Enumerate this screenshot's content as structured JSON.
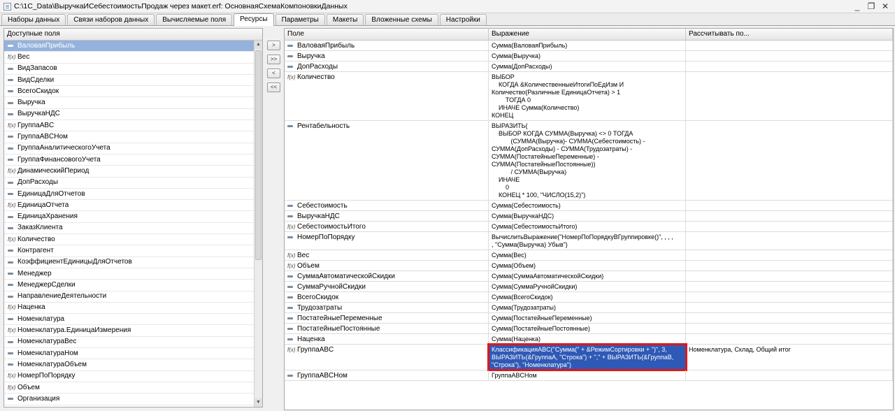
{
  "window": {
    "title": "C:\\1C_Data\\ВыручкаИСебестоимостьПродаж через макет.erf: ОсновнаяСхемаКомпоновкиДанных"
  },
  "tabs": [
    "Наборы данных",
    "Связи наборов данных",
    "Вычисляемые поля",
    "Ресурсы",
    "Параметры",
    "Макеты",
    "Вложенные схемы",
    "Настройки"
  ],
  "active_tab": "Ресурсы",
  "left": {
    "header": "Доступные поля",
    "items": [
      {
        "label": "ВаловаяПрибыль",
        "icon": "field",
        "selected": true
      },
      {
        "label": "Вес",
        "icon": "func"
      },
      {
        "label": "ВидЗапасов",
        "icon": "field"
      },
      {
        "label": "ВидСделки",
        "icon": "field"
      },
      {
        "label": "ВсегоСкидок",
        "icon": "field"
      },
      {
        "label": "Выручка",
        "icon": "field"
      },
      {
        "label": "ВыручкаНДС",
        "icon": "field"
      },
      {
        "label": "ГруппаABC",
        "icon": "func"
      },
      {
        "label": "ГруппаABCНом",
        "icon": "field"
      },
      {
        "label": "ГруппаАналитическогоУчета",
        "icon": "field"
      },
      {
        "label": "ГруппаФинансовогоУчета",
        "icon": "field"
      },
      {
        "label": "ДинамическийПериод",
        "icon": "func"
      },
      {
        "label": "ДопРасходы",
        "icon": "field"
      },
      {
        "label": "ЕдиницаДляОтчетов",
        "icon": "field"
      },
      {
        "label": "ЕдиницаОтчета",
        "icon": "func"
      },
      {
        "label": "ЕдиницаХранения",
        "icon": "field"
      },
      {
        "label": "ЗаказКлиента",
        "icon": "field"
      },
      {
        "label": "Количество",
        "icon": "func"
      },
      {
        "label": "Контрагент",
        "icon": "field"
      },
      {
        "label": "КоэффициентЕдиницыДляОтчетов",
        "icon": "field"
      },
      {
        "label": "Менеджер",
        "icon": "field"
      },
      {
        "label": "МенеджерСделки",
        "icon": "field"
      },
      {
        "label": "НаправлениеДеятельности",
        "icon": "field"
      },
      {
        "label": "Наценка",
        "icon": "func"
      },
      {
        "label": "Номенклатура",
        "icon": "field"
      },
      {
        "label": "Номенклатура.ЕдиницаИзмерения",
        "icon": "func"
      },
      {
        "label": "НоменклатураВес",
        "icon": "field"
      },
      {
        "label": "НоменклатураНом",
        "icon": "field"
      },
      {
        "label": "НоменклатураОбъем",
        "icon": "field"
      },
      {
        "label": "НомерПоПорядку",
        "icon": "func"
      },
      {
        "label": "Объем",
        "icon": "func"
      },
      {
        "label": "Организация",
        "icon": "field"
      }
    ]
  },
  "move_buttons": [
    ">",
    ">>",
    "<",
    "<<"
  ],
  "right": {
    "headers": [
      "Поле",
      "Выражение",
      "Рассчитывать по..."
    ],
    "rows": [
      {
        "field": "ВаловаяПрибыль",
        "icon": "field",
        "expr": "Сумма(ВаловаяПрибыль)",
        "calc": ""
      },
      {
        "field": "Выручка",
        "icon": "field",
        "expr": "Сумма(Выручка)",
        "calc": ""
      },
      {
        "field": "ДопРасходы",
        "icon": "field",
        "expr": "Сумма(ДопРасходы)",
        "calc": ""
      },
      {
        "field": "Количество",
        "icon": "func",
        "expr": "ВЫБОР\n    КОГДА &КоличественныеИтогиПоЕдИзм И\nКоличество(Различные ЕдиницаОтчета) > 1\n        ТОГДА 0\n    ИНАЧЕ Сумма(Количество)\nКОНЕЦ",
        "calc": ""
      },
      {
        "field": "Рентабельность",
        "icon": "field",
        "expr": "ВЫРАЗИТЬ(\n    ВЫБОР КОГДА СУММА(Выручка) <> 0 ТОГДА\n           (СУММА(Выручка)- СУММА(Себестоимость) -\nСУММА(ДопРасходы) - СУММА(Трудозатраты) -\nСУММА(ПостатейныеПеременные) -\nСУММА(ПостатейныеПостоянные))\n           / СУММА(Выручка)\n    ИНАЧЕ\n        0\n    КОНЕЦ * 100, \"ЧИСЛО(15,2)\")",
        "calc": ""
      },
      {
        "field": "Себестоимость",
        "icon": "field",
        "expr": "Сумма(Себестоимость)",
        "calc": ""
      },
      {
        "field": "ВыручкаНДС",
        "icon": "field",
        "expr": "Сумма(ВыручкаНДС)",
        "calc": ""
      },
      {
        "field": "СебестоимостьИтого",
        "icon": "func",
        "expr": "Сумма(СебестоимостьИтого)",
        "calc": ""
      },
      {
        "field": "НомерПоПорядку",
        "icon": "field",
        "expr": "ВычислитьВыражение(\"НомерПоПорядкуВГруппировке()\", , , ,\n, \"Сумма(Выручка) Убыв\")",
        "calc": ""
      },
      {
        "field": "Вес",
        "icon": "func",
        "expr": "Сумма(Вес)",
        "calc": ""
      },
      {
        "field": "Объем",
        "icon": "func",
        "expr": "Сумма(Объем)",
        "calc": ""
      },
      {
        "field": "СуммаАвтоматическойСкидки",
        "icon": "field",
        "expr": "Сумма(СуммаАвтоматическойСкидки)",
        "calc": ""
      },
      {
        "field": "СуммаРучнойСкидки",
        "icon": "field",
        "expr": "Сумма(СуммаРучнойСкидки)",
        "calc": ""
      },
      {
        "field": "ВсегоСкидок",
        "icon": "field",
        "expr": "Сумма(ВсегоСкидок)",
        "calc": ""
      },
      {
        "field": "Трудозатраты",
        "icon": "field",
        "expr": "Сумма(Трудозатраты)",
        "calc": ""
      },
      {
        "field": "ПостатейныеПеременные",
        "icon": "field",
        "expr": "Сумма(ПостатейныеПеременные)",
        "calc": ""
      },
      {
        "field": "ПостатейныеПостоянные",
        "icon": "field",
        "expr": "Сумма(ПостатейныеПостоянные)",
        "calc": ""
      },
      {
        "field": "Наценка",
        "icon": "field",
        "expr": "Сумма(Наценка)",
        "calc": ""
      },
      {
        "field": "ГруппаABC",
        "icon": "func",
        "expr": "КлассификацияABC(\"Сумма(\" + &РежимСортировки + \")\", 3,\nВЫРАЗИТЬ(&ГруппаA, \"Строка\") + \",\" + ВЫРАЗИТЬ(&ГруппаB,\n\"Строка\"), \"Номенклатура\")",
        "calc": "Номенклатура, Склад, Общий итог",
        "highlight": true
      },
      {
        "field": "ГруппаABCНом",
        "icon": "field",
        "expr": "ГруппаABCНом",
        "calc": ""
      }
    ]
  }
}
